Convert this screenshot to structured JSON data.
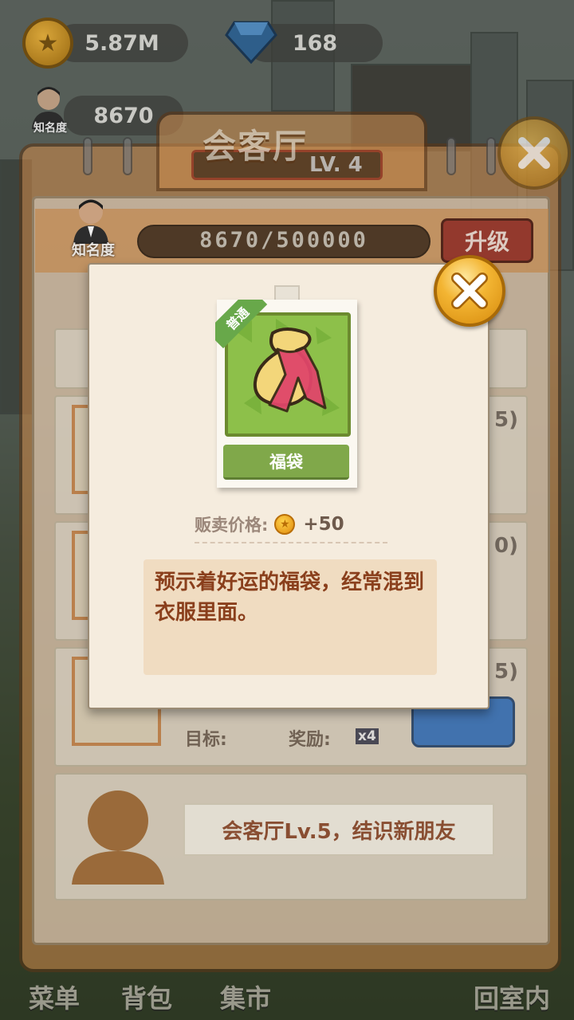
{
  "hud": {
    "coins": "5.87M",
    "gems": "168",
    "fame": "8670",
    "fame_label": "知名度"
  },
  "panel": {
    "title": "会客厅",
    "level": "LV. 4",
    "fame_label": "知名度",
    "fame_progress": "8670/500000",
    "upgrade_label": "升级",
    "goal_label": "目标:",
    "reward_label": "奖励:",
    "reward_multiplier": "x4",
    "side_numbers": [
      "5)",
      "0)",
      "5)"
    ],
    "next_friend_text": "会客厅Lv.5，结识新朋友"
  },
  "popup": {
    "rarity": "普通",
    "item_name": "福袋",
    "price_label": "贩卖价格:",
    "price_value": "+50",
    "description": "预示着好运的福袋，经常混到衣服里面。"
  },
  "bottom_nav": {
    "menu": "菜单",
    "bag": "背包",
    "market": "集市",
    "back_indoor": "回室内"
  },
  "colors": {
    "popup_bg": "#f5ecde",
    "item_name_green": "#80a84a",
    "description_text": "#8a3f1c",
    "close_button_gold": "#f3b533"
  }
}
